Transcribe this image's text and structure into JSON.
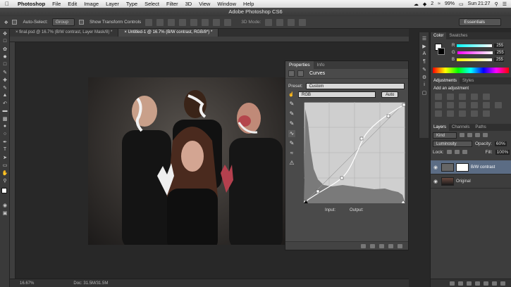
{
  "menubar": {
    "apple": "",
    "app": "Photoshop",
    "items": [
      "File",
      "Edit",
      "Image",
      "Layer",
      "Type",
      "Select",
      "Filter",
      "3D",
      "View",
      "Window",
      "Help"
    ],
    "status": {
      "battery": "99%",
      "clock": "Sun 21:27",
      "badge": "2"
    }
  },
  "window_title": "Adobe Photoshop CS6",
  "options": {
    "auto_select_label": "Auto-Select:",
    "auto_select_value": "Group",
    "transform_label": "Show Transform Controls",
    "mode3d": "3D Mode:",
    "workspace": "Essentials"
  },
  "tabs": [
    {
      "label": "final.psd @ 16.7% (B/W contrast, Layer Mask/8) *"
    },
    {
      "label": "Untitled-1 @ 16.7% (B/W contrast, RGB/8*) *"
    }
  ],
  "status": {
    "zoom": "16.67%",
    "doc": "Doc: 31.5M/31.5M"
  },
  "properties": {
    "tabs": [
      "Properties",
      "Info"
    ],
    "title": "Curves",
    "preset_label": "Preset:",
    "preset_value": "Custom",
    "channel": "RGB",
    "auto_button": "Auto",
    "input_label": "Input:",
    "output_label": "Output:"
  },
  "color_panel": {
    "tabs": [
      "Color",
      "Swatches"
    ],
    "r": "255",
    "g": "255",
    "b": "255",
    "r_label": "R",
    "g_label": "G",
    "b_label": "B"
  },
  "adjustments": {
    "tabs": [
      "Adjustments",
      "Styles"
    ],
    "hint": "Add an adjustment"
  },
  "layers": {
    "tabs": [
      "Layers",
      "Channels",
      "Paths"
    ],
    "filter": "Kind",
    "blend": "Luminosity",
    "opacity_label": "Opacity:",
    "opacity": "60%",
    "lock_label": "Lock:",
    "fill_label": "Fill:",
    "fill": "100%",
    "items": [
      {
        "name": "B/W contrast"
      },
      {
        "name": "Original"
      }
    ]
  },
  "colors": {
    "accent_selection": "#5b6c84",
    "panel": "#4a4a4a",
    "background": "#282828"
  }
}
